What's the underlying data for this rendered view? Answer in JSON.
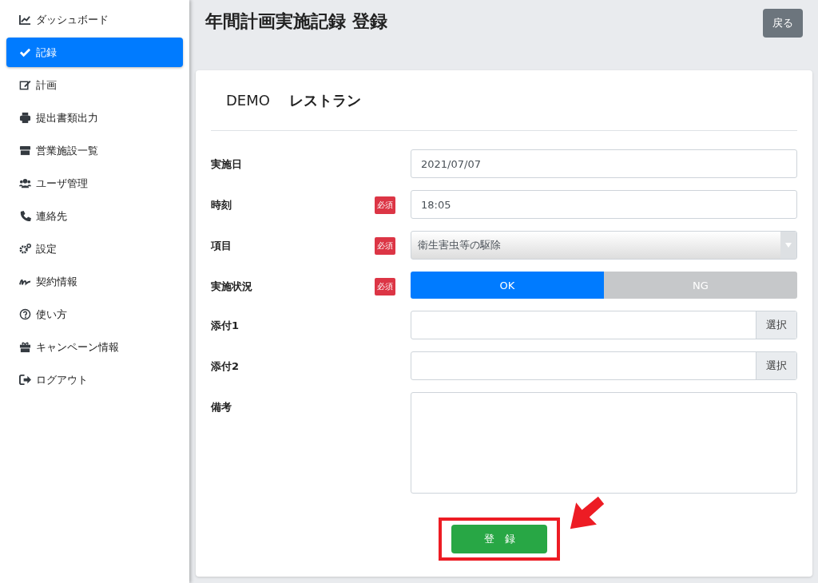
{
  "sidebar": {
    "items": [
      {
        "label": "ダッシュボード",
        "selected": false
      },
      {
        "label": "記録",
        "selected": true
      },
      {
        "label": "計画",
        "selected": false
      },
      {
        "label": "提出書類出力",
        "selected": false
      },
      {
        "label": "営業施設一覧",
        "selected": false
      },
      {
        "label": "ユーザ管理",
        "selected": false
      },
      {
        "label": "連絡先",
        "selected": false
      },
      {
        "label": "設定",
        "selected": false
      },
      {
        "label": "契約情報",
        "selected": false
      },
      {
        "label": "使い方",
        "selected": false
      },
      {
        "label": "キャンペーン情報",
        "selected": false
      },
      {
        "label": "ログアウト",
        "selected": false
      }
    ]
  },
  "page": {
    "title": "年間計画実施記録 登録",
    "back_button": "戻る"
  },
  "card": {
    "company": "DEMO",
    "store": "レストラン",
    "fields": [
      {
        "kind": "text",
        "label": "実施日",
        "required": false,
        "value": "2021/07/07"
      },
      {
        "kind": "text",
        "label": "時刻",
        "required": true,
        "badge": "必須",
        "value": "18:05"
      },
      {
        "kind": "select",
        "label": "項目",
        "required": true,
        "badge": "必須",
        "value": "衛生害虫等の駆除"
      },
      {
        "kind": "toggle",
        "label": "実施状況",
        "required": true,
        "badge": "必須",
        "options": [
          {
            "label": "OK",
            "selected": true
          },
          {
            "label": "NG",
            "selected": false
          }
        ]
      },
      {
        "kind": "file",
        "label": "添付1",
        "required": false,
        "button": "選択"
      },
      {
        "kind": "file",
        "label": "添付2",
        "required": false,
        "button": "選択"
      },
      {
        "kind": "textarea",
        "label": "備考",
        "required": false
      }
    ],
    "submit_button": "登　録",
    "submit_highlighted": true
  }
}
